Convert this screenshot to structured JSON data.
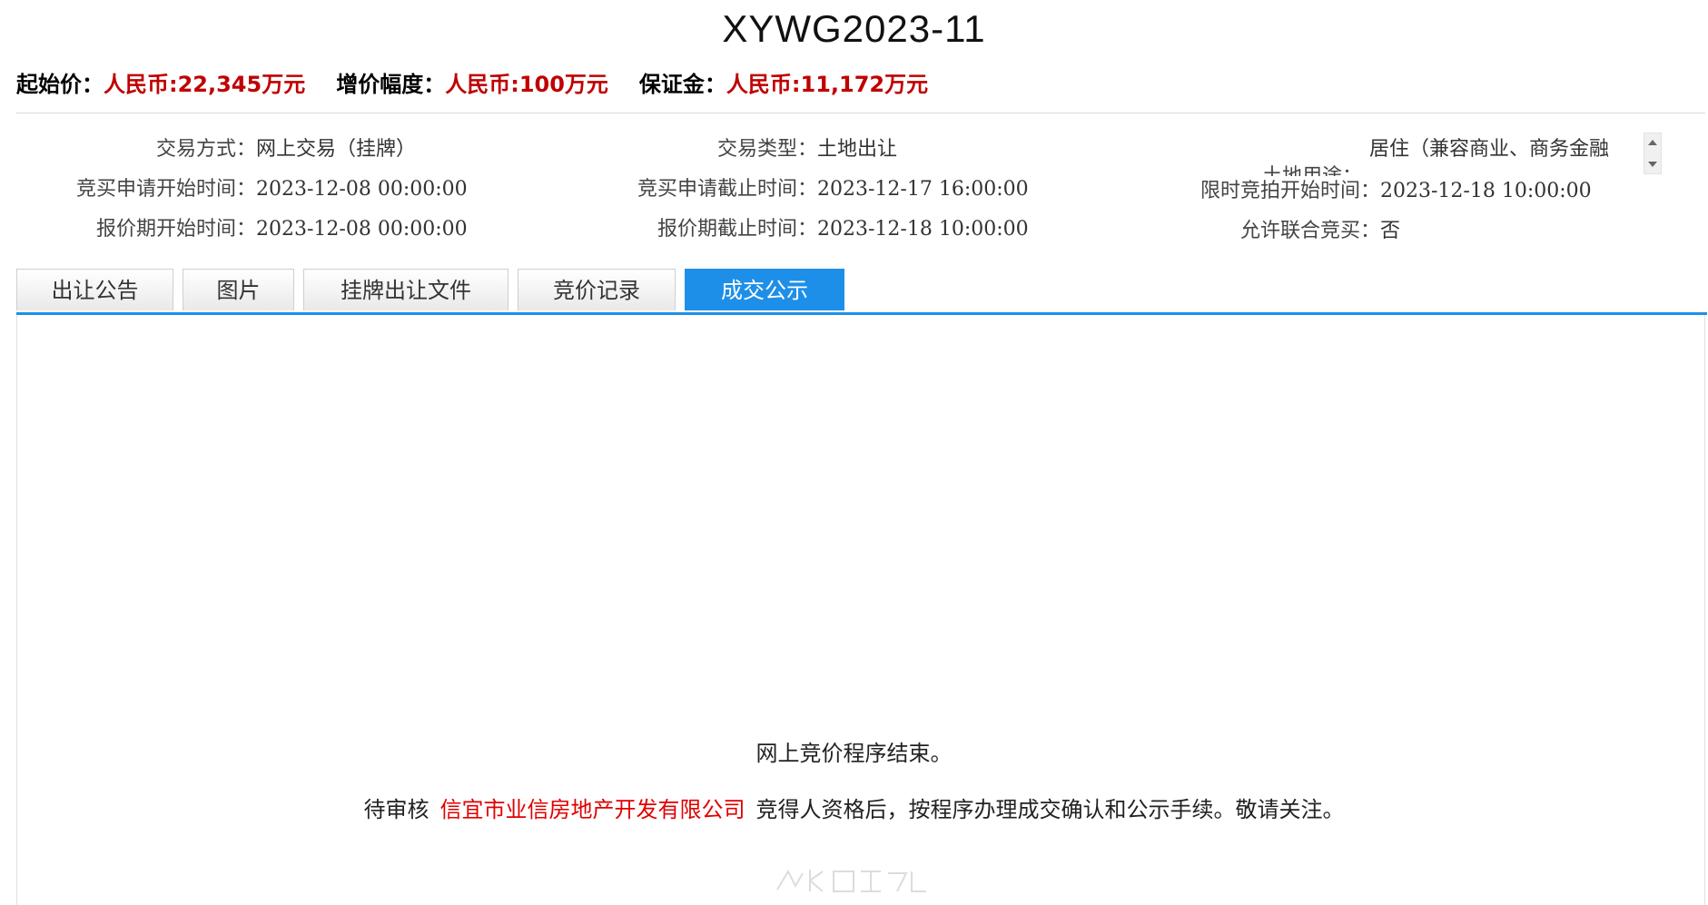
{
  "title": "XYWG2023-11",
  "prices": {
    "start_label": "起始价：",
    "start_value": "人民币:22,345万元",
    "increment_label": "增价幅度：",
    "increment_value": "人民币:100万元",
    "deposit_label": "保证金：",
    "deposit_value": "人民币:11,172万元"
  },
  "info": {
    "trade_method_label": "交易方式：",
    "trade_method": "网上交易（挂牌）",
    "trade_type_label": "交易类型：",
    "trade_type": "土地出让",
    "land_use_label": "土地用途：",
    "land_use": "居住（兼容商业、商务金融",
    "apply_start_label": "竞买申请开始时间：",
    "apply_start": "2023-12-08 00:00:00",
    "apply_end_label": "竞买申请截止时间：",
    "apply_end": "2023-12-17 16:00:00",
    "timed_bid_start_label": "限时竞拍开始时间：",
    "timed_bid_start": "2023-12-18 10:00:00",
    "quote_start_label": "报价期开始时间：",
    "quote_start": "2023-12-08 00:00:00",
    "quote_end_label": "报价期截止时间：",
    "quote_end": "2023-12-18 10:00:00",
    "joint_bid_label": "允许联合竞买：",
    "joint_bid": "否"
  },
  "tabs": [
    {
      "label": "出让公告",
      "active": false
    },
    {
      "label": "图片",
      "active": false
    },
    {
      "label": "挂牌出让文件",
      "active": false
    },
    {
      "label": "竞价记录",
      "active": false
    },
    {
      "label": "成交公示",
      "active": true
    }
  ],
  "result": {
    "line1": "网上竞价程序结束。",
    "prefix": "待审核",
    "winner": "信宜市业信房地产开发有限公司",
    "suffix": "竞得人资格后，按程序办理成交确认和公示手续。敬请关注。"
  },
  "colors": {
    "accent": "#1e8fe8",
    "price_red": "#c00000",
    "winner_red": "#e00000"
  },
  "icons": {
    "scroll_up": "triangle-up-icon",
    "scroll_down": "triangle-down-icon"
  }
}
